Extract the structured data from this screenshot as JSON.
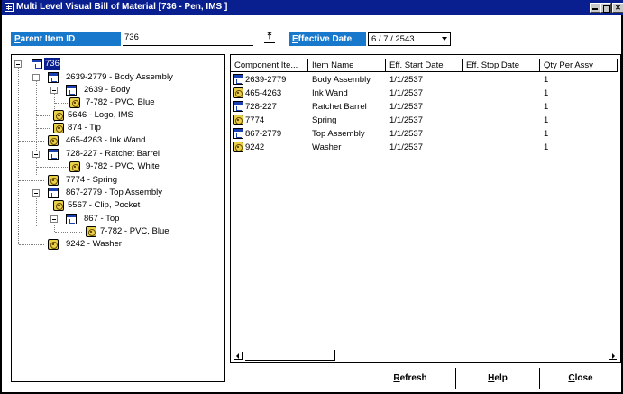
{
  "window": {
    "title": "Multi Level Visual Bill of Material  [736 - Pen, IMS ]",
    "controls": [
      "minimize",
      "maximize",
      "close"
    ]
  },
  "header": {
    "parent_label_accel": "P",
    "parent_label_rest": "arent Item ID",
    "parent_value": "736",
    "effective_label_accel": "E",
    "effective_label_rest": "ffective Date",
    "effective_value": "6 / 7 / 2543",
    "lookup_icon": "lookup-arrow-icon"
  },
  "tree": {
    "root": "736",
    "nodes": [
      {
        "label": "2639-2779 - Body Assembly",
        "icon": "assembly-icon"
      },
      {
        "label": "2639 - Body",
        "icon": "assembly-icon"
      },
      {
        "label": "7-782 - PVC, Blue",
        "icon": "part-icon"
      },
      {
        "label": "5646 - Logo, IMS",
        "icon": "part-icon"
      },
      {
        "label": "874 - Tip",
        "icon": "part-icon"
      },
      {
        "label": "465-4263 - Ink Wand",
        "icon": "part-icon"
      },
      {
        "label": "728-227 - Ratchet Barrel",
        "icon": "assembly-icon"
      },
      {
        "label": "9-782 - PVC, White",
        "icon": "part-icon"
      },
      {
        "label": "7774 - Spring",
        "icon": "part-icon"
      },
      {
        "label": "867-2779 - Top Assembly",
        "icon": "assembly-icon"
      },
      {
        "label": "5567 - Clip, Pocket",
        "icon": "part-icon"
      },
      {
        "label": "867 - Top",
        "icon": "assembly-icon"
      },
      {
        "label": "7-782 - PVC, Blue",
        "icon": "part-icon"
      },
      {
        "label": "9242 - Washer",
        "icon": "part-icon"
      }
    ]
  },
  "grid": {
    "columns": [
      "Component Ite...",
      "Item Name",
      "Eff. Start Date",
      "Eff. Stop Date",
      "Qty Per Assy"
    ],
    "rows": [
      {
        "icon": "assembly-icon",
        "component": "2639-2779",
        "name": "Body Assembly",
        "start": "1/1/2537",
        "stop": "",
        "qty": "1"
      },
      {
        "icon": "part-icon",
        "component": "465-4263",
        "name": "Ink Wand",
        "start": "1/1/2537",
        "stop": "",
        "qty": "1"
      },
      {
        "icon": "assembly-icon",
        "component": "728-227",
        "name": "Ratchet Barrel",
        "start": "1/1/2537",
        "stop": "",
        "qty": "1"
      },
      {
        "icon": "part-icon",
        "component": "7774",
        "name": "Spring",
        "start": "1/1/2537",
        "stop": "",
        "qty": "1"
      },
      {
        "icon": "assembly-icon",
        "component": "867-2779",
        "name": "Top Assembly",
        "start": "1/1/2537",
        "stop": "",
        "qty": "1"
      },
      {
        "icon": "part-icon",
        "component": "9242",
        "name": "Washer",
        "start": "1/1/2537",
        "stop": "",
        "qty": "1"
      }
    ]
  },
  "buttons": {
    "refresh_accel": "R",
    "refresh_rest": "efresh",
    "help_accel": "H",
    "help_rest": "elp",
    "close_accel": "C",
    "close_rest": "lose"
  },
  "colors": {
    "titlebar": "#0a1f8f",
    "field_label": "#1878cc",
    "selection": "#0a1f8f",
    "part_icon": "#e8d048"
  }
}
